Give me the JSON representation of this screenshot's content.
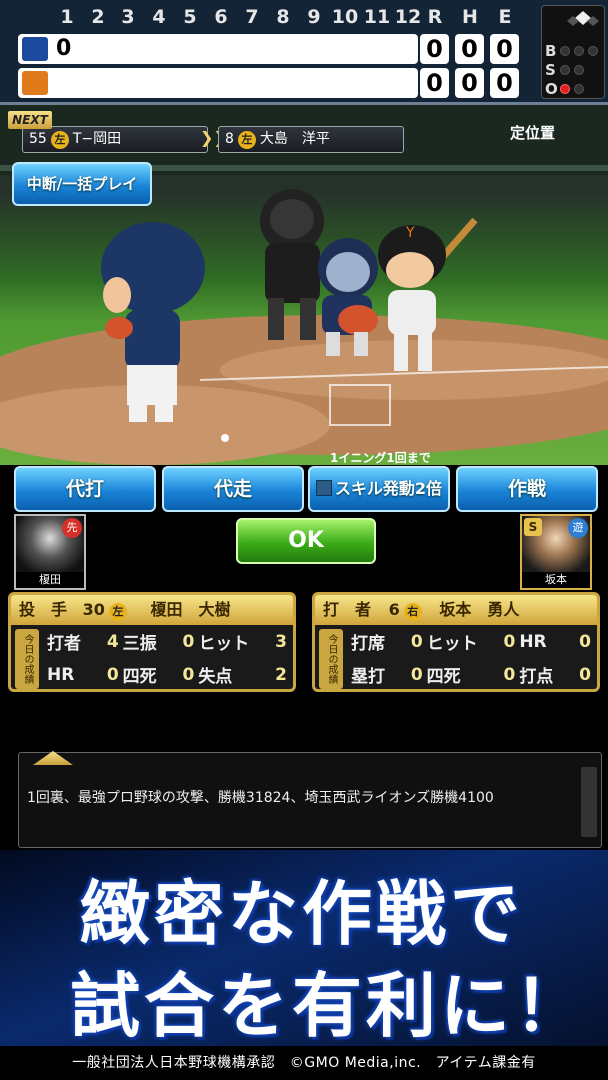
{
  "scoreboard": {
    "innings": [
      "1",
      "2",
      "3",
      "4",
      "5",
      "6",
      "7",
      "8",
      "9",
      "10",
      "11",
      "12"
    ],
    "rhe_headers": [
      "R",
      "H",
      "E"
    ],
    "away": {
      "innings_score": "0",
      "r": "0",
      "h": "0",
      "e": "0",
      "logo_color": "#1c4a9c"
    },
    "home": {
      "innings_score": "",
      "r": "0",
      "h": "0",
      "e": "0",
      "logo_color": "#e07a1a"
    },
    "bso_labels": [
      "B",
      "S",
      "O"
    ],
    "outs_on": 1
  },
  "next_batter": {
    "tag": "NEXT",
    "first": {
      "number": "55",
      "hand": "左",
      "name": "T−岡田"
    },
    "second": {
      "number": "8",
      "hand": "左",
      "name": "大島　洋平"
    }
  },
  "position_label": "定位置",
  "menu_button": "中断/一括プレイ",
  "inning_limit_note": "1イニング1回まで",
  "action_buttons": {
    "pinch_hit": "代打",
    "pinch_run": "代走",
    "skill_double": "スキル発動2倍",
    "strategy": "作戦"
  },
  "ok_label": "OK",
  "pitcher_card": {
    "name": "榎田",
    "badge": "先"
  },
  "batter_card": {
    "name": "坂本",
    "badge": "遊",
    "rank": "S"
  },
  "pitcher_stats": {
    "role": "投　手",
    "number": "30",
    "hand": "左",
    "name": "榎田　大樹",
    "tab": "今日の成績",
    "labels": [
      "打者",
      "三振",
      "ヒット",
      "HR",
      "四死",
      "失点"
    ],
    "values": [
      "4",
      "0",
      "3",
      "0",
      "0",
      "2"
    ]
  },
  "batter_stats": {
    "role": "打　者",
    "number": "6",
    "hand": "右",
    "name": "坂本　勇人",
    "tab": "今日の成績",
    "labels": [
      "打席",
      "ヒット",
      "HR",
      "塁打",
      "四死",
      "打点"
    ],
    "values": [
      "0",
      "0",
      "0",
      "0",
      "0",
      "0"
    ]
  },
  "message": "1回裏、最強プロ野球の攻撃、勝機31824、埼玉西武ライオンズ勝機4100",
  "banner": {
    "line1": "緻密な作戦で",
    "line2": "試合を有利に！"
  },
  "footer": "一般社団法人日本野球機構承認　©GMO Media,inc.　アイテム課金有"
}
